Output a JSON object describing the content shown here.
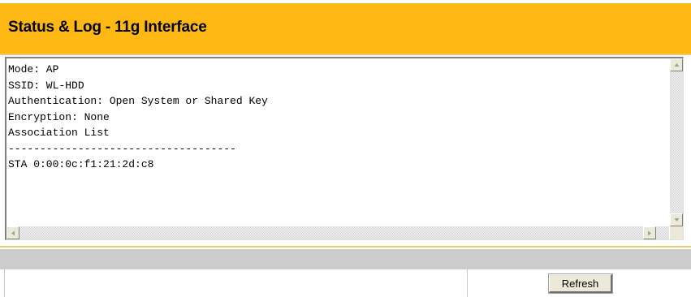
{
  "header": {
    "title": "Status & Log - 11g Interface"
  },
  "log": {
    "lines": [
      "Mode: AP",
      "SSID: WL-HDD",
      "Authentication: Open System or Shared Key",
      "Encryption: None",
      "Association List",
      "------------------------------------",
      "STA 0:00:0c:f1:21:2d:c8"
    ]
  },
  "footer": {
    "refresh_label": "Refresh"
  },
  "icons": {
    "scroll_up": "arrow-up-icon",
    "scroll_down": "arrow-down-icon",
    "scroll_left": "arrow-left-icon",
    "scroll_right": "arrow-right-icon"
  },
  "colors": {
    "header_bg": "#fdb813",
    "gray_bar": "#cccccc"
  }
}
